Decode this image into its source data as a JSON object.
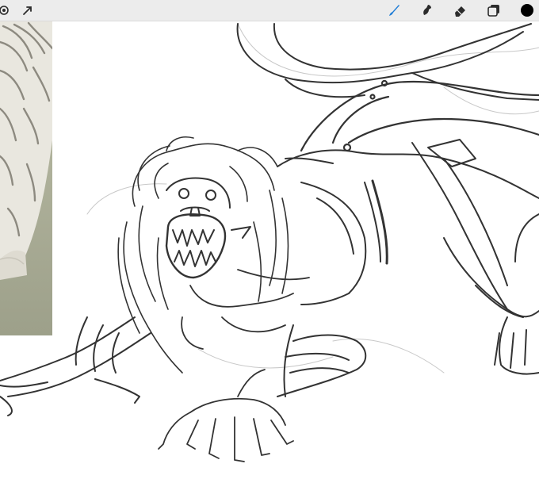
{
  "app": {
    "toolbar": {
      "left_tools": [
        {
          "icon": "settings-icon"
        },
        {
          "icon": "selection-arrow-icon"
        }
      ],
      "right_tools": [
        {
          "icon": "brush-icon",
          "active": true
        },
        {
          "icon": "smudge-icon",
          "active": false
        },
        {
          "icon": "eraser-icon",
          "active": false
        },
        {
          "icon": "layers-icon",
          "active": false
        },
        {
          "icon": "color-swatch-icon",
          "active": false
        }
      ]
    },
    "colors": {
      "toolbar_bg": "#ececec",
      "active_tool": "#1e7cd6",
      "icon": "#2b2b2b",
      "current_color": "#000000",
      "canvas": "#ffffff",
      "sketch_stroke": "#333333"
    },
    "canvas": {
      "reference_image": {
        "subject": "white-tiger-photo"
      },
      "artwork": {
        "subject": "pencil-sketch-creature"
      }
    }
  }
}
